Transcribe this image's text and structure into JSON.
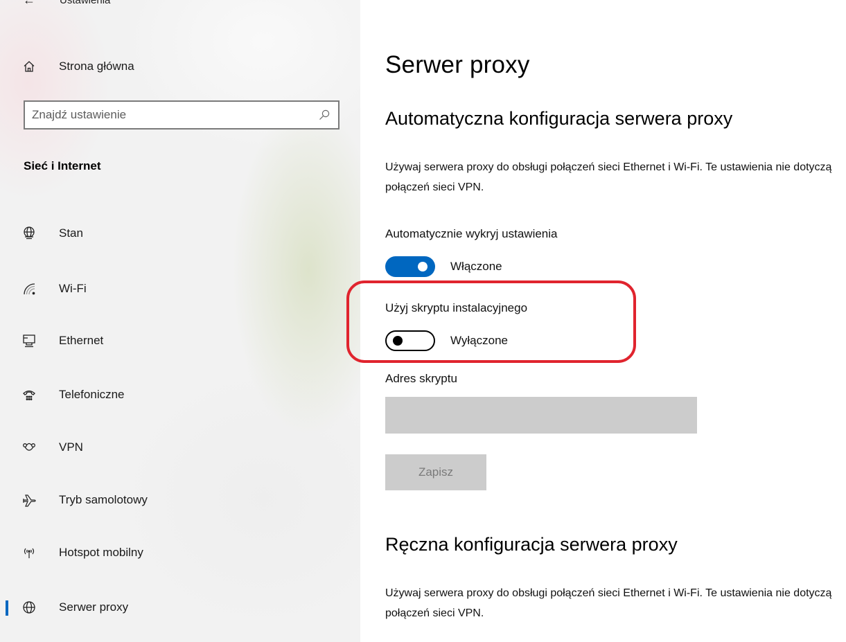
{
  "app": {
    "back_icon": "back-arrow-icon",
    "window_title": "Ustawienia"
  },
  "sidebar": {
    "home": {
      "label": "Strona główna",
      "icon": "home-icon"
    },
    "search": {
      "placeholder": "Znajdź ustawienie",
      "value": "",
      "icon": "search-icon"
    },
    "section_title": "Sieć i Internet",
    "items": [
      {
        "label": "Stan",
        "icon": "globe-status-icon",
        "selected": false
      },
      {
        "label": "Wi-Fi",
        "icon": "wifi-icon",
        "selected": false
      },
      {
        "label": "Ethernet",
        "icon": "ethernet-icon",
        "selected": false
      },
      {
        "label": "Telefoniczne",
        "icon": "dial-up-icon",
        "selected": false
      },
      {
        "label": "VPN",
        "icon": "vpn-icon",
        "selected": false
      },
      {
        "label": "Tryb samolotowy",
        "icon": "airplane-icon",
        "selected": false
      },
      {
        "label": "Hotspot mobilny",
        "icon": "hotspot-icon",
        "selected": false
      },
      {
        "label": "Serwer proxy",
        "icon": "globe-icon",
        "selected": true
      }
    ],
    "accent_color": "#0067c0"
  },
  "main": {
    "title": "Serwer proxy",
    "auto": {
      "title": "Automatyczna konfiguracja serwera proxy",
      "description": "Używaj serwera proxy do obsługi połączeń sieci Ethernet i Wi-Fi. Te ustawienia nie dotyczą połączeń sieci VPN.",
      "detect": {
        "label": "Automatycznie wykryj ustawienia",
        "state": "Włączone",
        "on": true
      },
      "script": {
        "label": "Użyj skryptu instalacyjnego",
        "state": "Wyłączone",
        "on": false
      },
      "address": {
        "label": "Adres skryptu",
        "value": ""
      },
      "save_label": "Zapisz"
    },
    "manual": {
      "title": "Ręczna konfiguracja serwera proxy",
      "description": "Używaj serwera proxy do obsługi połączeń sieci Ethernet i Wi-Fi. Te ustawienia nie dotyczą połączeń sieci VPN."
    },
    "annotation_color": "#e0242e"
  }
}
